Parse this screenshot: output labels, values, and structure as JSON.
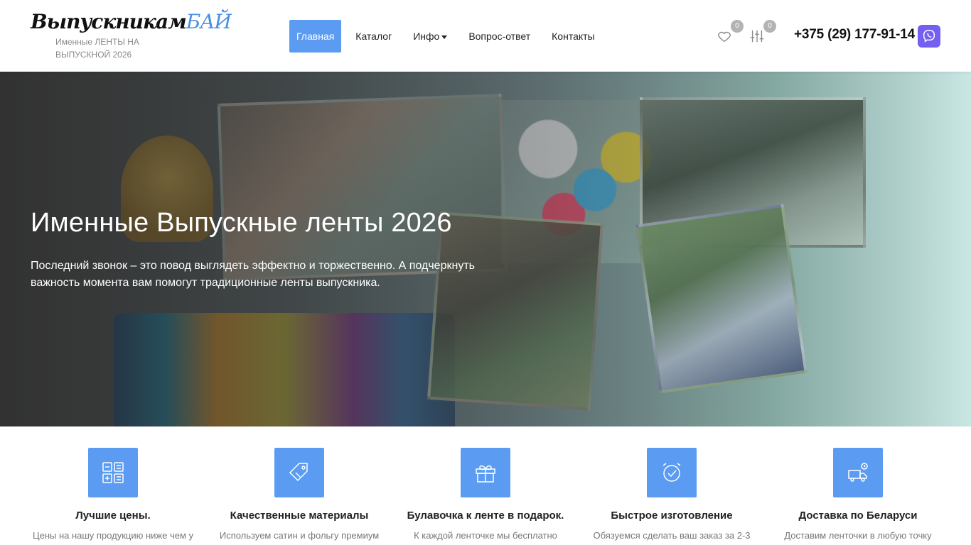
{
  "header": {
    "logo_main": "Выпускникам",
    "logo_accent": "БАЙ",
    "tagline": "Именные ЛЕНТЫ НА ВЫПУСКНОЙ 2026",
    "nav": [
      {
        "label": "Главная",
        "active": true
      },
      {
        "label": "Каталог"
      },
      {
        "label": "Инфо",
        "dropdown": true
      },
      {
        "label": "Вопрос-ответ"
      },
      {
        "label": "Контакты"
      }
    ],
    "wishlist_count": "0",
    "compare_count": "0",
    "phone": "+375 (29) 177-91-14",
    "icons": {
      "wishlist": "heart-icon",
      "compare": "sliders-icon",
      "messenger": "viber-icon"
    }
  },
  "hero": {
    "title": "Именные Выпускные ленты 2026",
    "text": "Последний звонок – это повод выглядеть эффектно и торжественно. А подчеркнуть важность момента вам помогут традиционные ленты выпускника."
  },
  "features": [
    {
      "icon": "calculator-icon",
      "title": "Лучшие цены.",
      "desc": "Цены на нашу продукцию ниже чем у"
    },
    {
      "icon": "tag-icon",
      "title": "Качественные материалы",
      "desc": "Используем сатин и фольгу премиум"
    },
    {
      "icon": "gift-icon",
      "title": "Булавочка к ленте в подарок.",
      "desc": "К каждой ленточке мы бесплатно"
    },
    {
      "icon": "alarm-clock-icon",
      "title": "Быстрое изготовление",
      "desc": "Обязуемся сделать ваш заказ за 2-3"
    },
    {
      "icon": "delivery-icon",
      "title": "Доставка по Беларуси",
      "desc": "Доставим ленточки в любую точку"
    }
  ],
  "colors": {
    "accent": "#5b9cf2",
    "viber": "#7360f2",
    "badge": "#b3b3b3"
  }
}
